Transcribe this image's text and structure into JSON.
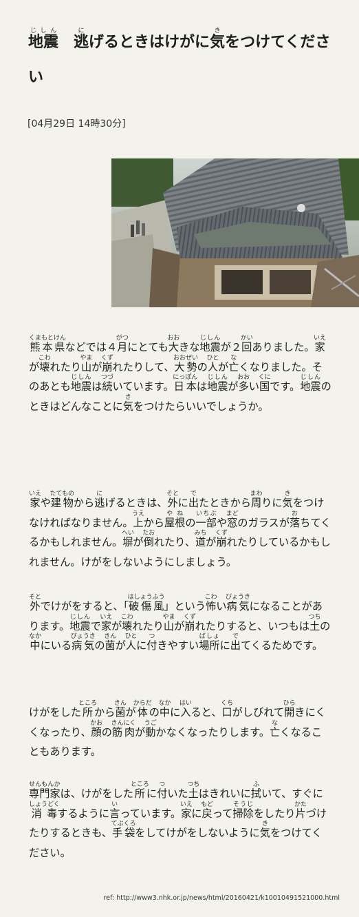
{
  "article": {
    "title_kanji_1": "地震",
    "title_reading_1": "じしん",
    "title_kanji_2": "逃",
    "title_reading_2": "に",
    "title_text_2": "げるときはけがに",
    "title_kanji_3": "気",
    "title_reading_3": "き",
    "title_text_3": "をつけてください",
    "date": "[04月29日 14時30分]",
    "photo_alt": "地震で壊れた家の写真"
  },
  "paragraphs": [
    {
      "tokens": [
        {
          "t": " "
        },
        {
          "t": "熊本県",
          "r": "くまもとけん"
        },
        {
          "t": "などでは４"
        },
        {
          "t": "月",
          "r": "がつ"
        },
        {
          "t": "にとても"
        },
        {
          "t": "大",
          "r": "おお"
        },
        {
          "t": "きな"
        },
        {
          "t": "地震",
          "r": "じしん"
        },
        {
          "t": "が２"
        },
        {
          "t": "回",
          "r": "かい"
        },
        {
          "t": "ありました。"
        },
        {
          "t": "家",
          "r": "いえ"
        },
        {
          "t": "が"
        },
        {
          "t": "壊",
          "r": "こわ"
        },
        {
          "t": "れたり"
        },
        {
          "t": "山",
          "r": "やま"
        },
        {
          "t": "が"
        },
        {
          "t": "崩",
          "r": "くず"
        },
        {
          "t": "れたりして、"
        },
        {
          "t": "大勢",
          "r": "おおぜい"
        },
        {
          "t": "の"
        },
        {
          "t": "人",
          "r": "ひと"
        },
        {
          "t": "が"
        },
        {
          "t": "亡",
          "r": "な"
        },
        {
          "t": "くなりました。そのあとも"
        },
        {
          "t": "地震",
          "r": "じしん"
        },
        {
          "t": "は"
        },
        {
          "t": "続",
          "r": "つづ"
        },
        {
          "t": "いています。"
        },
        {
          "t": "日本",
          "r": "にっぽん"
        },
        {
          "t": "は"
        },
        {
          "t": "地震",
          "r": "じしん"
        },
        {
          "t": "が"
        },
        {
          "t": "多",
          "r": "おお"
        },
        {
          "t": "い"
        },
        {
          "t": "国",
          "r": "くに"
        },
        {
          "t": "です。"
        },
        {
          "t": "地震",
          "r": "じしん"
        },
        {
          "t": "のときはどんなことに"
        },
        {
          "t": "気",
          "r": "き"
        },
        {
          "t": "をつけたらいいでしょうか。"
        }
      ]
    },
    {
      "tokens": [
        {
          "t": "家",
          "r": "いえ"
        },
        {
          "t": "や"
        },
        {
          "t": "建物",
          "r": "たてもの"
        },
        {
          "t": "から"
        },
        {
          "t": "逃",
          "r": "に"
        },
        {
          "t": "げるときは、"
        },
        {
          "t": "外",
          "r": "そと"
        },
        {
          "t": "に"
        },
        {
          "t": "出",
          "r": "で"
        },
        {
          "t": "たときから"
        },
        {
          "t": "周",
          "r": "まわ"
        },
        {
          "t": "りに"
        },
        {
          "t": "気",
          "r": "き"
        },
        {
          "t": "をつけなければなりません。"
        },
        {
          "t": "上",
          "r": "うえ"
        },
        {
          "t": "から"
        },
        {
          "t": "屋根",
          "r": "やね"
        },
        {
          "t": "の"
        },
        {
          "t": "一部",
          "r": "いちぶ"
        },
        {
          "t": "や"
        },
        {
          "t": "窓",
          "r": "まど"
        },
        {
          "t": "のガラスが"
        },
        {
          "t": "落",
          "r": "お"
        },
        {
          "t": "ちてくるかもしれません。"
        },
        {
          "t": "塀",
          "r": "へい"
        },
        {
          "t": "が"
        },
        {
          "t": "倒",
          "r": "たお"
        },
        {
          "t": "れたり、"
        },
        {
          "t": "道",
          "r": "みち"
        },
        {
          "t": "が"
        },
        {
          "t": "崩",
          "r": "くず"
        },
        {
          "t": "れたりしているかもしれません。けがをしないようにしましょう。"
        }
      ]
    },
    {
      "tokens": [
        {
          "t": "外",
          "r": "そと"
        },
        {
          "t": "でけがをすると、「"
        },
        {
          "t": "破傷風",
          "r": "はしょうふう"
        },
        {
          "t": "」という"
        },
        {
          "t": "怖",
          "r": "こわ"
        },
        {
          "t": "い"
        },
        {
          "t": "病気",
          "r": "びょうき"
        },
        {
          "t": "になることがあります。"
        },
        {
          "t": "地震",
          "r": "じしん"
        },
        {
          "t": "で"
        },
        {
          "t": "家",
          "r": "いえ"
        },
        {
          "t": "が"
        },
        {
          "t": "壊",
          "r": "こわ"
        },
        {
          "t": "れたり"
        },
        {
          "t": "山",
          "r": "やま"
        },
        {
          "t": "が"
        },
        {
          "t": "崩",
          "r": "くず"
        },
        {
          "t": "れたりすると、いつもは"
        },
        {
          "t": "土",
          "r": "つち"
        },
        {
          "t": "の"
        },
        {
          "t": "中",
          "r": "なか"
        },
        {
          "t": "にいる"
        },
        {
          "t": "病気",
          "r": "びょうき"
        },
        {
          "t": "の"
        },
        {
          "t": "菌",
          "r": "きん"
        },
        {
          "t": "が"
        },
        {
          "t": "人",
          "r": "ひと"
        },
        {
          "t": "に"
        },
        {
          "t": "付",
          "r": "つ"
        },
        {
          "t": "きやすい"
        },
        {
          "t": "場所",
          "r": "ばしょ"
        },
        {
          "t": "に"
        },
        {
          "t": "出",
          "r": "で"
        },
        {
          "t": "てくるためです。"
        }
      ]
    },
    {
      "tokens": [
        {
          "t": "けがをした"
        },
        {
          "t": "所",
          "r": "ところ"
        },
        {
          "t": "から"
        },
        {
          "t": "菌",
          "r": "きん"
        },
        {
          "t": "が"
        },
        {
          "t": "体",
          "r": "からだ"
        },
        {
          "t": "の"
        },
        {
          "t": "中",
          "r": "なか"
        },
        {
          "t": "に"
        },
        {
          "t": "入",
          "r": "はい"
        },
        {
          "t": "ると、"
        },
        {
          "t": "口",
          "r": "くち"
        },
        {
          "t": "がしびれて"
        },
        {
          "t": "開",
          "r": "ひら"
        },
        {
          "t": "きにくくなったり、"
        },
        {
          "t": "顔",
          "r": "かお"
        },
        {
          "t": "の"
        },
        {
          "t": "筋肉",
          "r": "きんにく"
        },
        {
          "t": "が"
        },
        {
          "t": "動",
          "r": "うご"
        },
        {
          "t": "かなくなったりします。"
        },
        {
          "t": "亡",
          "r": "な"
        },
        {
          "t": "くなることもあります。"
        }
      ]
    },
    {
      "tokens": [
        {
          "t": "専門家",
          "r": "せんもんか"
        },
        {
          "t": "は、けがをした"
        },
        {
          "t": "所",
          "r": "ところ"
        },
        {
          "t": "に"
        },
        {
          "t": "付",
          "r": "つ"
        },
        {
          "t": "いた"
        },
        {
          "t": "土",
          "r": "つち"
        },
        {
          "t": "はきれいに"
        },
        {
          "t": "拭",
          "r": "ふ"
        },
        {
          "t": "いて、すぐに"
        },
        {
          "t": "消毒",
          "r": "しょうどく"
        },
        {
          "t": "するように"
        },
        {
          "t": "言",
          "r": "い"
        },
        {
          "t": "っています。"
        },
        {
          "t": "家",
          "r": "いえ"
        },
        {
          "t": "に"
        },
        {
          "t": "戻",
          "r": "もど"
        },
        {
          "t": "って"
        },
        {
          "t": "掃除",
          "r": "そうじ"
        },
        {
          "t": "をしたり"
        },
        {
          "t": "片",
          "r": "かた"
        },
        {
          "t": "づけたりするときも、"
        },
        {
          "t": "手袋",
          "r": "てぶくろ"
        },
        {
          "t": "をしてけがをしないように"
        },
        {
          "t": "気",
          "r": "き"
        },
        {
          "t": "をつけてください。"
        }
      ]
    }
  ],
  "footer": {
    "ref": "ref: http://www3.nhk.or.jp/news/html/20160421/k10010491521000.html"
  }
}
